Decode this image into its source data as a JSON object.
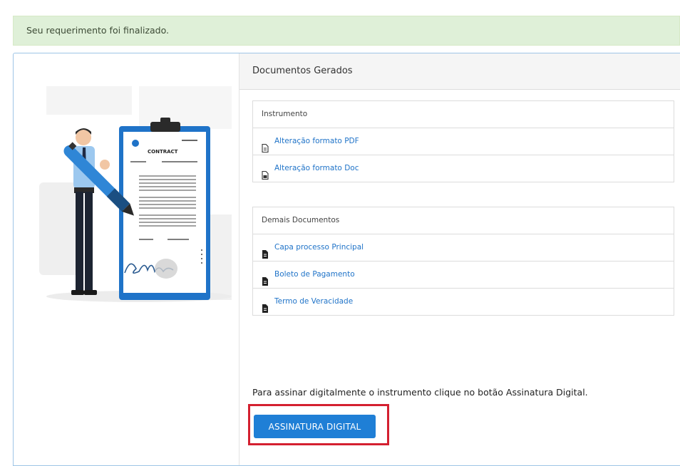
{
  "alert": {
    "message": "Seu requerimento foi finalizado."
  },
  "illustration": {
    "contract_label": "CONTRACT"
  },
  "panel": {
    "title": "Documentos Gerados"
  },
  "instrumento": {
    "header": "Instrumento",
    "items": [
      {
        "label": "Alteração formato PDF",
        "icon": "pdf-file-icon"
      },
      {
        "label": "Alteração formato Doc",
        "icon": "doc-file-icon"
      }
    ]
  },
  "demais": {
    "header": "Demais Documentos",
    "items": [
      {
        "label": "Capa processo Principal",
        "icon": "file-icon"
      },
      {
        "label": "Boleto de Pagamento",
        "icon": "file-icon"
      },
      {
        "label": "Termo de Veracidade",
        "icon": "file-icon"
      }
    ]
  },
  "signature": {
    "instruction": "Para assinar digitalmente o instrumento clique no botão Assinatura Digital.",
    "button_label": "ASSINATURA DIGITAL"
  },
  "colors": {
    "alert_bg": "#dff0d8",
    "link": "#1f73c8",
    "button": "#1f7fd6",
    "highlight": "#d42030"
  }
}
